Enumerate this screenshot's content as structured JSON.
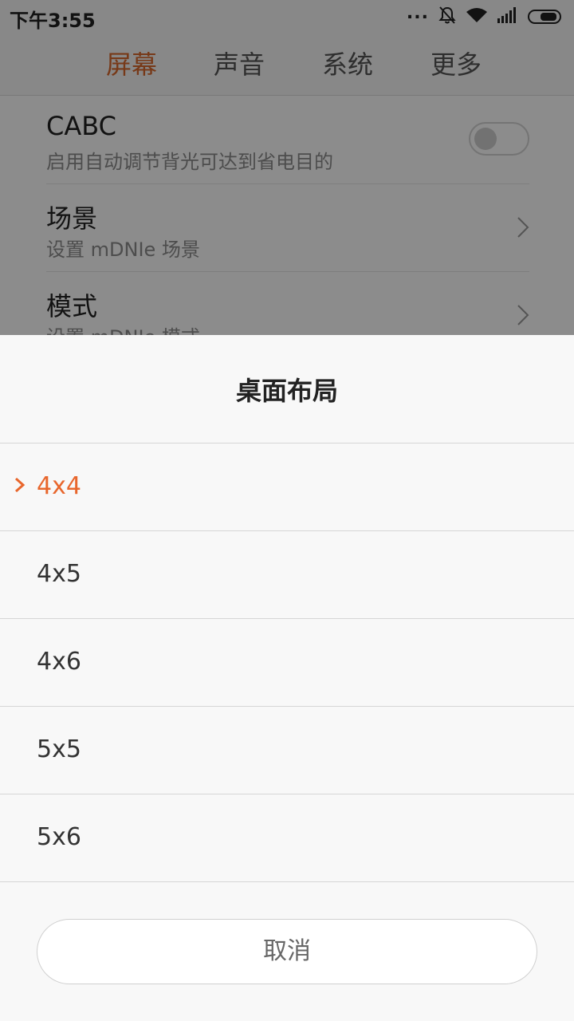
{
  "status_bar": {
    "time": "下午3:55",
    "dots": "...",
    "icons": [
      "bell-off-icon",
      "wifi-icon",
      "signal-icon",
      "battery-icon"
    ]
  },
  "tabs": [
    {
      "label": "屏幕",
      "active": true
    },
    {
      "label": "声音",
      "active": false
    },
    {
      "label": "系统",
      "active": false
    },
    {
      "label": "更多",
      "active": false
    }
  ],
  "settings": {
    "cabc": {
      "title": "CABC",
      "subtitle": "启用自动调节背光可达到省电目的",
      "enabled": false
    },
    "scene": {
      "title": "场景",
      "subtitle": "设置 mDNIe 场景"
    },
    "mode": {
      "title": "模式",
      "subtitle": "设置 mDNIe 模式"
    }
  },
  "dialog": {
    "title": "桌面布局",
    "options": [
      {
        "label": "4x4",
        "selected": true
      },
      {
        "label": "4x5",
        "selected": false
      },
      {
        "label": "4x6",
        "selected": false
      },
      {
        "label": "5x5",
        "selected": false
      },
      {
        "label": "5x6",
        "selected": false
      }
    ],
    "cancel_label": "取消"
  },
  "colors": {
    "accent": "#e8662c",
    "tab_active": "#d9682c",
    "text_primary": "#222222",
    "text_secondary": "#8c8c8c",
    "sheet_bg": "#f8f8f8"
  }
}
